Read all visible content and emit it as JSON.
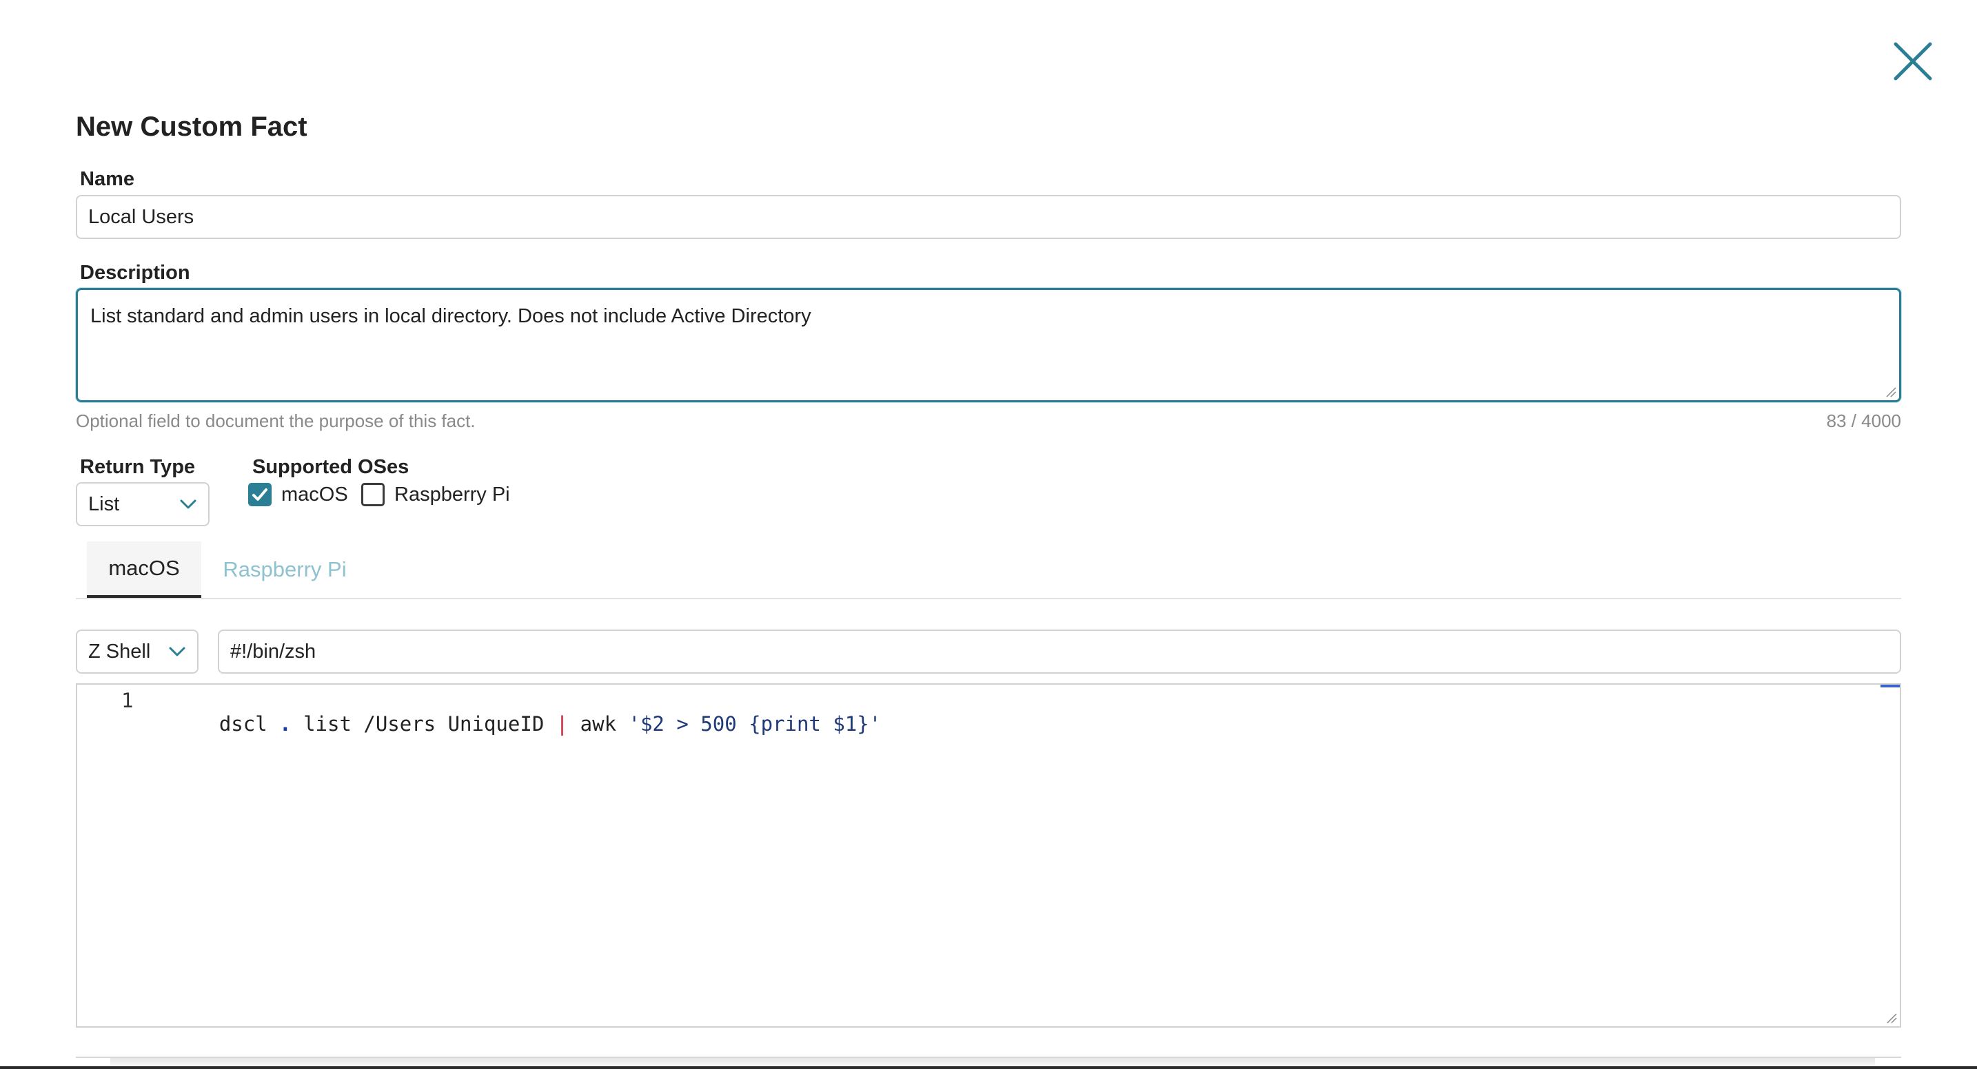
{
  "dialog": {
    "title": "New Custom Fact",
    "close_icon": "close-icon"
  },
  "form": {
    "name": {
      "label": "Name",
      "value": "Local Users"
    },
    "description": {
      "label": "Description",
      "value": "List standard and admin users in local directory. Does not include Active Directory",
      "hint": "Optional field to document the purpose of this fact.",
      "counter": "83 / 4000"
    },
    "return_type": {
      "label": "Return Type",
      "selected": "List"
    },
    "supported_oses": {
      "label": "Supported OSes",
      "options": [
        {
          "label": "macOS",
          "checked": true
        },
        {
          "label": "Raspberry Pi",
          "checked": false
        }
      ]
    }
  },
  "tabs": [
    {
      "label": "macOS",
      "active": true
    },
    {
      "label": "Raspberry Pi",
      "active": false
    }
  ],
  "script": {
    "shell": "Z Shell",
    "shebang": "#!/bin/zsh",
    "lines": [
      {
        "number": "1",
        "tokens": [
          {
            "text": "dscl ",
            "kind": "plain"
          },
          {
            "text": ".",
            "kind": "op"
          },
          {
            "text": " list /Users UniqueID ",
            "kind": "plain"
          },
          {
            "text": "|",
            "kind": "pipe"
          },
          {
            "text": " awk ",
            "kind": "plain"
          },
          {
            "text": "'$2 > 500 {print $1}'",
            "kind": "str"
          }
        ]
      }
    ]
  },
  "colors": {
    "accent": "#2a7f95",
    "inactive_tab": "#8fc2cf",
    "hint_text": "#8a8a8a"
  }
}
